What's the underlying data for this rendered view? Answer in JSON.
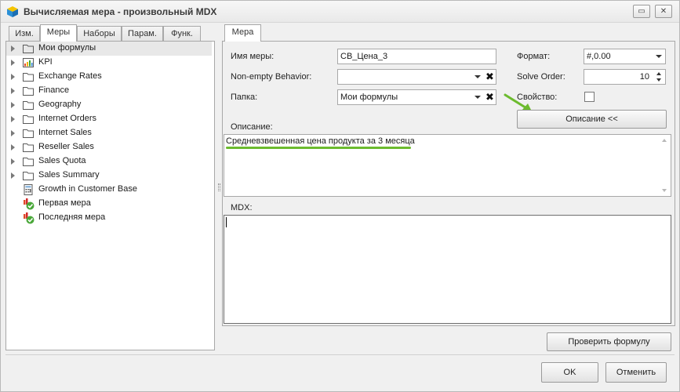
{
  "window": {
    "title": "Вычисляемая мера - произвольный MDX",
    "minimize_label": "▭",
    "close_label": "✕"
  },
  "left_tabs": [
    "Изм.",
    "Меры",
    "Наборы",
    "Парам.",
    "Функ."
  ],
  "tree": [
    {
      "label": "Мои формулы",
      "icon": "folder-icon",
      "expandable": true
    },
    {
      "label": "KPI",
      "icon": "kpi-icon",
      "expandable": true
    },
    {
      "label": "Exchange Rates",
      "icon": "folder-icon",
      "expandable": true
    },
    {
      "label": "Finance",
      "icon": "folder-icon",
      "expandable": true
    },
    {
      "label": "Geography",
      "icon": "folder-icon",
      "expandable": true
    },
    {
      "label": "Internet Orders",
      "icon": "folder-icon",
      "expandable": true
    },
    {
      "label": "Internet Sales",
      "icon": "folder-icon",
      "expandable": true
    },
    {
      "label": "Reseller Sales",
      "icon": "folder-icon",
      "expandable": true
    },
    {
      "label": "Sales Quota",
      "icon": "folder-icon",
      "expandable": true
    },
    {
      "label": "Sales Summary",
      "icon": "folder-icon",
      "expandable": true
    },
    {
      "label": "Growth in Customer Base",
      "icon": "calculator-icon",
      "expandable": false
    },
    {
      "label": "Первая мера",
      "icon": "measure-check-icon",
      "expandable": false
    },
    {
      "label": "Последняя мера",
      "icon": "measure-check-icon",
      "expandable": false
    }
  ],
  "right_tab": "Мера",
  "form": {
    "name_label": "Имя меры:",
    "name_value": "СВ_Цена_3",
    "nonempty_label": "Non-empty Behavior:",
    "nonempty_value": "",
    "folder_label": "Папка:",
    "folder_value": "Мои формулы",
    "format_label": "Формат:",
    "format_value": "#,0.00",
    "solve_label": "Solve Order:",
    "solve_value": "10",
    "property_label": "Свойство:",
    "clear_glyph": "✖",
    "description_button": "Описание <<",
    "description_label": "Описание:",
    "description_value": "Средневзвешенная цена продукта за 3 месяца",
    "mdx_label": "MDX:",
    "mdx_value": ""
  },
  "buttons": {
    "check_formula": "Проверить формулу",
    "ok": "OK",
    "cancel": "Отменить"
  },
  "colors": {
    "annotation_green": "#6cbb2e",
    "folder_stroke": "#5a5a5a"
  }
}
